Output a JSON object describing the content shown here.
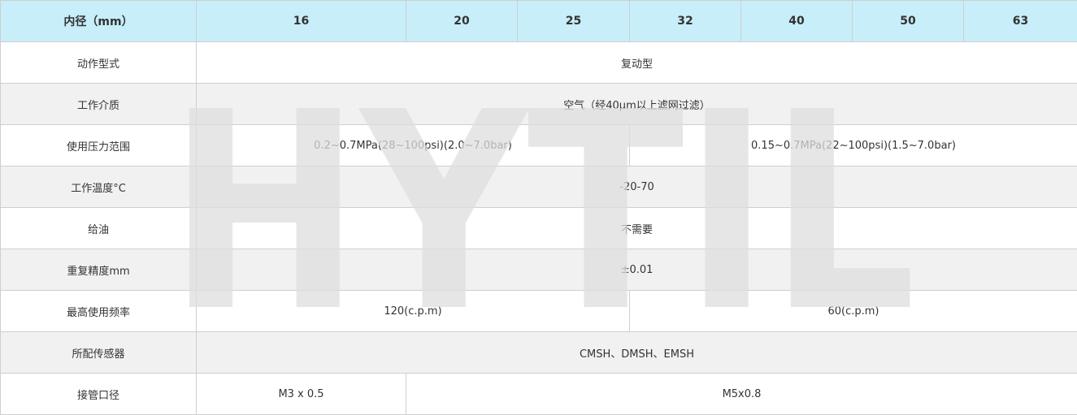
{
  "header": {
    "label": "内径（mm）",
    "bores": [
      "16",
      "20",
      "25",
      "32",
      "40",
      "50",
      "63"
    ]
  },
  "rows": {
    "action": {
      "label": "动作型式",
      "value": "复动型"
    },
    "medium": {
      "label": "工作介质",
      "value": "空气（经40μm以上滤网过滤）"
    },
    "pressure": {
      "label": "使用压力范围",
      "value_small": "0.2~0.7MPa(28~100psi)(2.0~7.0bar)",
      "value_large": "0.15~0.7MPa(22~100psi)(1.5~7.0bar)"
    },
    "temperature": {
      "label": "工作温度°C",
      "value": "-20-70"
    },
    "lubrication": {
      "label": "给油",
      "value": "不需要"
    },
    "repeatability": {
      "label": "重复精度mm",
      "value": "±0.01"
    },
    "frequency": {
      "label": "最高使用频率",
      "value_small": "120(c.p.m)",
      "value_large": "60(c.p.m)"
    },
    "sensor": {
      "label": "所配传感器",
      "value": "CMSH、DMSH、EMSH"
    },
    "port": {
      "label": "接管口径",
      "value_small": "M3 x 0.5",
      "value_large": "M5x0.8"
    }
  },
  "watermark": {
    "text": "HYTIL",
    "color": "#dedede"
  },
  "colors": {
    "header_bg": "#c7eef9",
    "row_alt_bg": "#f1f1f1",
    "border": "#cfcfcf"
  }
}
